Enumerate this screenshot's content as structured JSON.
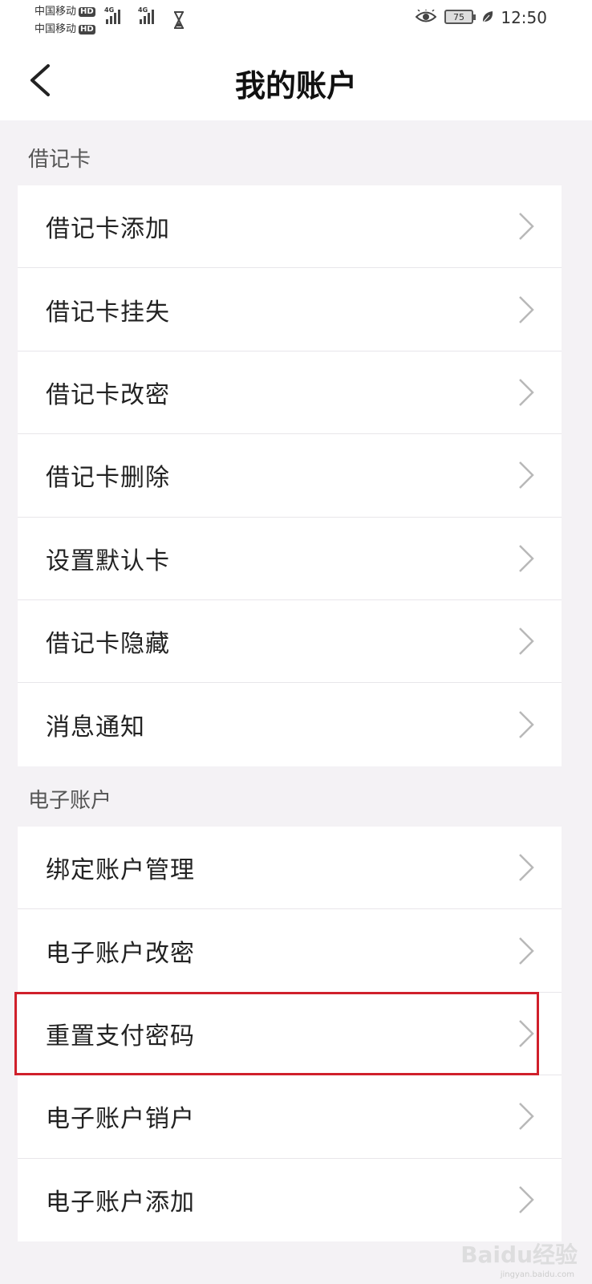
{
  "status_bar": {
    "carrier_1": "中国移动",
    "carrier_2": "中国移动",
    "hd_label": "HD",
    "network_1": "4G",
    "network_2": "4G",
    "battery_level": "75",
    "time": "12:50"
  },
  "nav": {
    "title": "我的账户",
    "back_icon": "chevron-left-icon"
  },
  "debit_card": {
    "header": "借记卡",
    "items": [
      {
        "label": "借记卡添加"
      },
      {
        "label": "借记卡挂失"
      },
      {
        "label": "借记卡改密"
      },
      {
        "label": "借记卡删除"
      },
      {
        "label": "设置默认卡"
      },
      {
        "label": "借记卡隐藏"
      },
      {
        "label": "消息通知"
      }
    ]
  },
  "e_account": {
    "header": "电子账户",
    "items": [
      {
        "label": "绑定账户管理"
      },
      {
        "label": "电子账户改密"
      },
      {
        "label": "重置支付密码",
        "highlighted": true
      },
      {
        "label": "电子账户销户"
      },
      {
        "label": "电子账户添加"
      }
    ]
  },
  "highlight_color": "#d0202b",
  "watermark": {
    "text": "Baidu经验",
    "sub": "jingyan.baidu.com"
  }
}
